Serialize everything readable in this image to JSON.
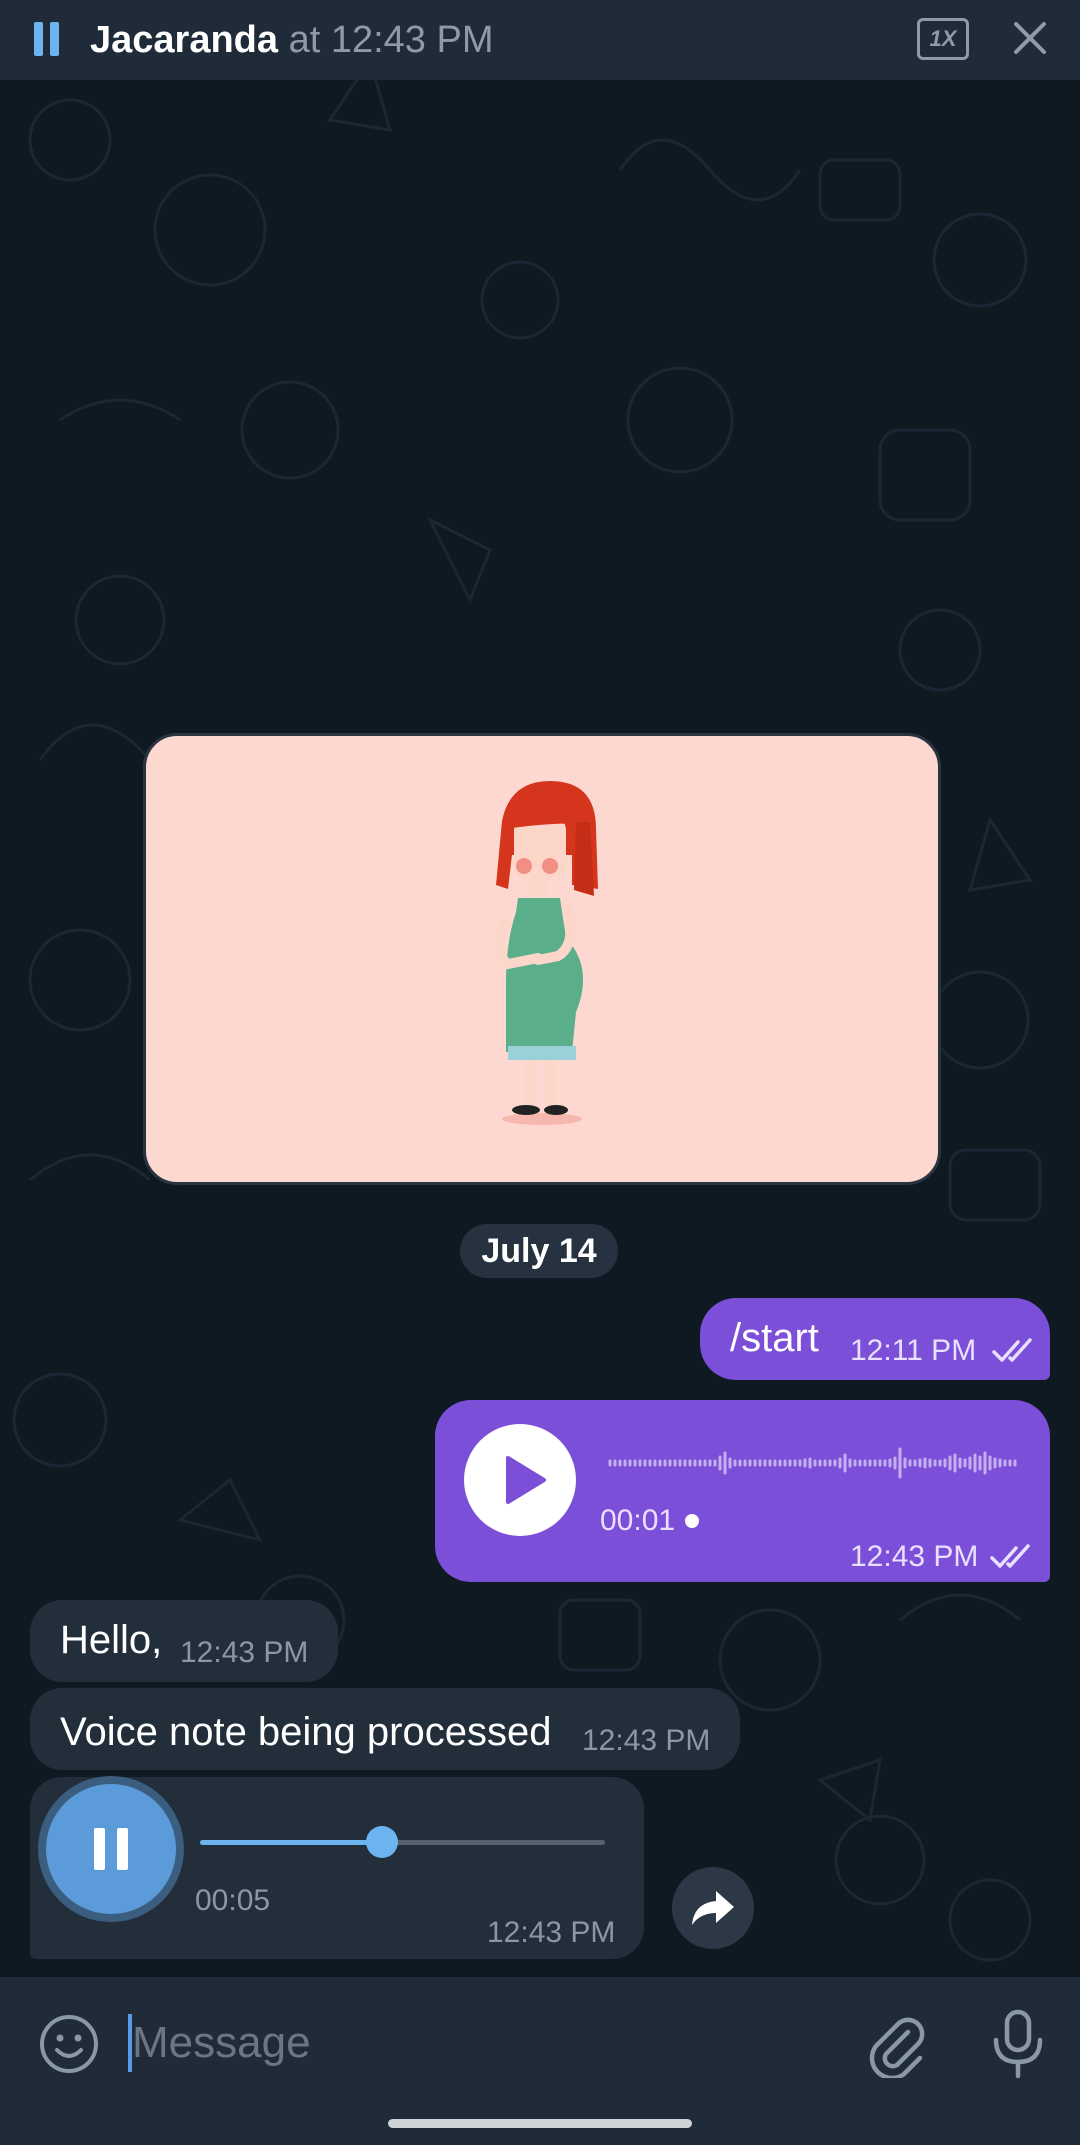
{
  "player": {
    "title_name": "Jacaranda",
    "title_separator": " at ",
    "title_time": "12:43 PM",
    "speed": "1X",
    "pause_icon": "pause-icon",
    "close_icon": "close-icon"
  },
  "chat": {
    "date_separator": "July 14",
    "messages": [
      {
        "kind": "image",
        "icon": "illustration-pregnant-woman"
      },
      {
        "kind": "outgoing-text",
        "text": "/start",
        "time": "12:11 PM",
        "status_icon": "double-check-icon"
      },
      {
        "kind": "outgoing-voice",
        "duration": "00:01",
        "time": "12:43 PM",
        "status_icon": "double-check-icon",
        "icon": "play-icon"
      },
      {
        "kind": "incoming-text",
        "text": "Hello,",
        "time": "12:43 PM"
      },
      {
        "kind": "incoming-text",
        "text": "Voice note being processed",
        "time": "12:43 PM"
      },
      {
        "kind": "incoming-voice",
        "elapsed": "00:05",
        "time": "12:43 PM",
        "progress": 0.45,
        "icon": "pause-icon"
      }
    ],
    "share_icon": "share-icon"
  },
  "composer": {
    "placeholder": "Message",
    "emoji_icon": "emoji-icon",
    "attach_icon": "paperclip-icon",
    "mic_icon": "microphone-icon"
  },
  "colors": {
    "background": "#0f1922",
    "bar": "#1f2b38",
    "outgoing_bubble": "#7c4fd8",
    "incoming_bubble": "#222e3a",
    "accent": "#6cb4f0"
  }
}
